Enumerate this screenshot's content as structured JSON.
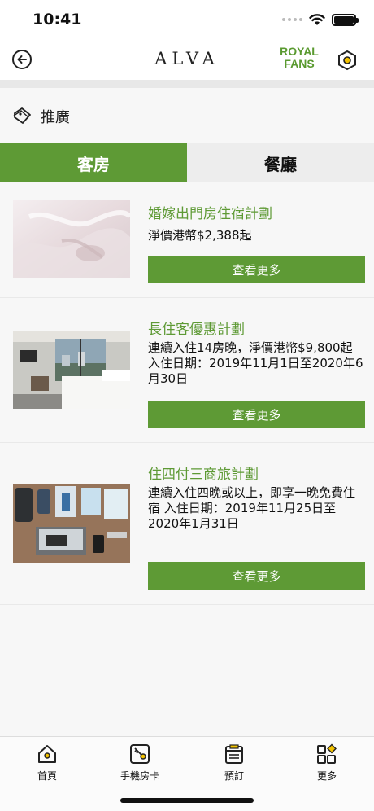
{
  "status": {
    "time": "10:41"
  },
  "header": {
    "brand": "ALVA",
    "royal_line1": "ROYAL",
    "royal_line2": "FANS"
  },
  "section": {
    "title": "推廣"
  },
  "tabs": [
    {
      "label": "客房",
      "active": true
    },
    {
      "label": "餐廳",
      "active": false
    }
  ],
  "cards": [
    {
      "title": "婚嫁出門房住宿計劃",
      "desc": "淨價港幣$2,388起",
      "button": "查看更多"
    },
    {
      "title": "長住客優惠計劃",
      "desc": "連續入住14房晚，淨價港幣$9,800起 入住日期：2019年11月1日至2020年6月30日",
      "button": "查看更多"
    },
    {
      "title": "住四付三商旅計劃",
      "desc": "連續入住四晚或以上，即享一晚免費住宿 入住日期：2019年11月25日至2020年1月31日",
      "button": "查看更多"
    }
  ],
  "bottom_nav": [
    {
      "label": "首頁",
      "icon": "home-icon"
    },
    {
      "label": "手機房卡",
      "icon": "key-card-icon"
    },
    {
      "label": "預訂",
      "icon": "booking-icon"
    },
    {
      "label": "更多",
      "icon": "more-icon"
    }
  ],
  "colors": {
    "accent": "#5e9a35",
    "royal": "#5a9a30",
    "tab_inactive": "#ededed"
  }
}
